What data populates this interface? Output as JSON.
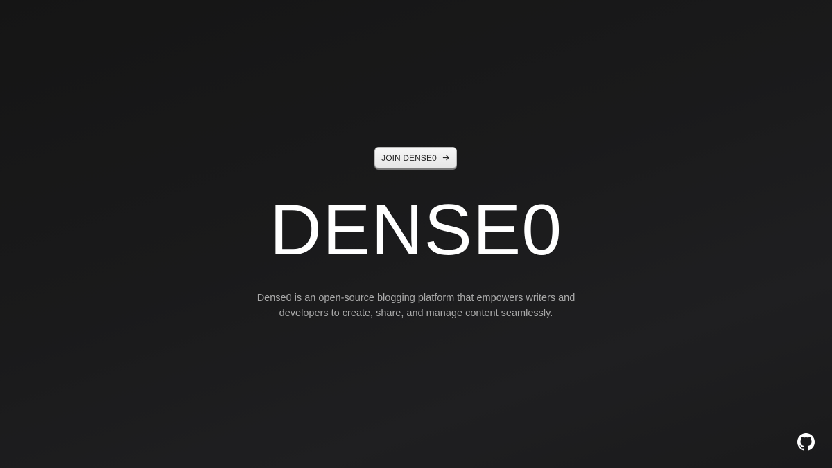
{
  "hero": {
    "cta_label": "JOIN DENSE0",
    "cta_icon": "arrow-right-icon",
    "title": "DENSE0",
    "description": "Dense0 is an open-source blogging platform that empowers writers and developers to create, share, and manage content seamlessly."
  },
  "footer": {
    "github_icon": "github-icon"
  },
  "colors": {
    "background": "#1a1a1b",
    "title": "#ffffff",
    "description": "#a9a9a9",
    "button_bg": "#eeeeee",
    "button_text": "#262626"
  }
}
